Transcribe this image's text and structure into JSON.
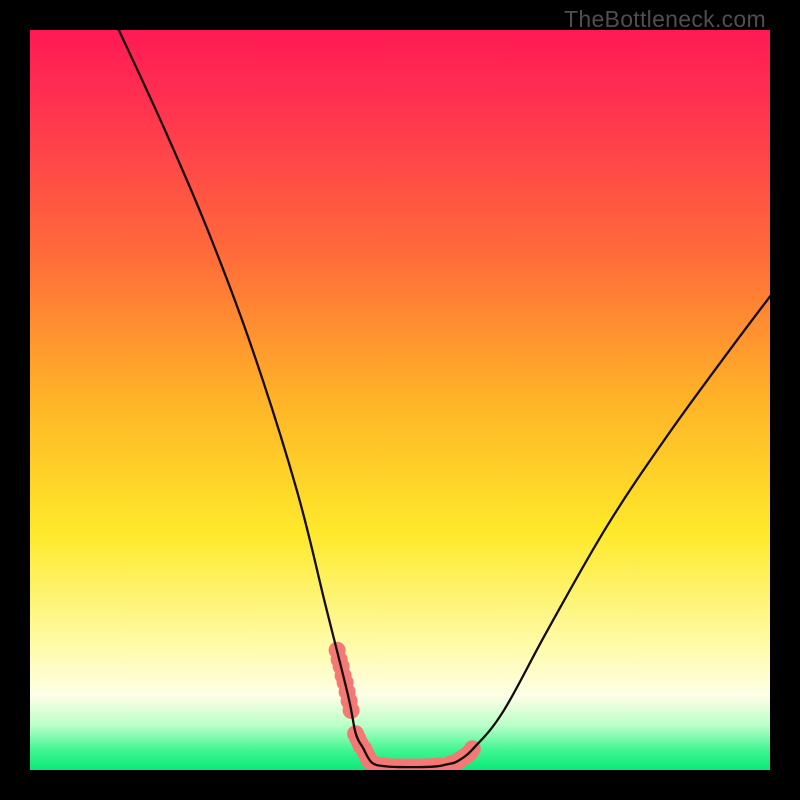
{
  "watermark": "TheBottleneck.com",
  "chart_data": {
    "type": "line",
    "title": "",
    "xlabel": "",
    "ylabel": "",
    "xlim": [
      0,
      100
    ],
    "ylim": [
      0,
      100
    ],
    "series": [
      {
        "name": "left-arm",
        "x": [
          12,
          18,
          24,
          30,
          36,
          40,
          43,
          44,
          45,
          46.2
        ],
        "y": [
          100,
          87,
          73,
          57,
          38,
          22,
          10,
          5,
          3,
          1
        ]
      },
      {
        "name": "floor",
        "x": [
          46.2,
          48,
          50,
          53,
          55,
          56.5,
          57.8
        ],
        "y": [
          1,
          0.5,
          0.4,
          0.4,
          0.5,
          0.8,
          1.2
        ]
      },
      {
        "name": "right-arm",
        "x": [
          57.8,
          60,
          64,
          70,
          78,
          86,
          94,
          100
        ],
        "y": [
          1.2,
          3,
          8,
          19,
          33,
          45,
          56,
          64
        ]
      }
    ],
    "highlight_mask": {
      "description": "Salmon overlay along the curve near the bottom",
      "ranges_x": [
        [
          41.5,
          43.5
        ],
        [
          44,
          55.5
        ],
        [
          56.8,
          59.8
        ]
      ]
    },
    "gradient_stops": [
      {
        "offset": 0.0,
        "color": "#ff1a54"
      },
      {
        "offset": 0.1,
        "color": "#ff3250"
      },
      {
        "offset": 0.3,
        "color": "#ff6a3a"
      },
      {
        "offset": 0.5,
        "color": "#ffb327"
      },
      {
        "offset": 0.68,
        "color": "#fee92a"
      },
      {
        "offset": 0.84,
        "color": "#fffcb0"
      },
      {
        "offset": 0.9,
        "color": "#fdfee7"
      },
      {
        "offset": 0.94,
        "color": "#b9ffc8"
      },
      {
        "offset": 0.975,
        "color": "#3bf58f"
      },
      {
        "offset": 1.0,
        "color": "#0ce979"
      }
    ],
    "curve_color": "#120c0a",
    "highlight_color": "#f47874"
  }
}
